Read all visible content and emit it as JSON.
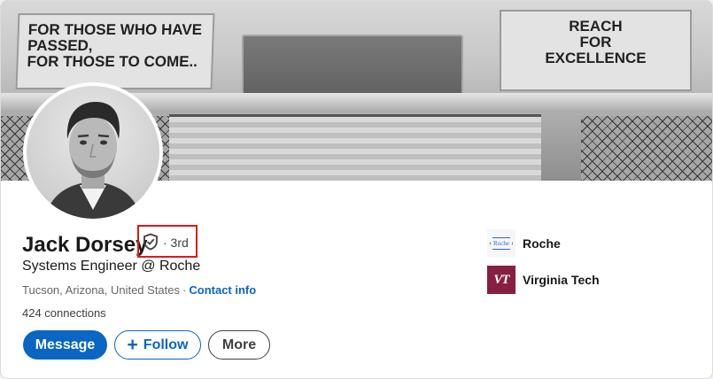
{
  "banner": {
    "left_plaque": [
      "FOR THOSE WHO HAVE",
      "PASSED,",
      "FOR THOSE TO COME.."
    ],
    "right_plaque": [
      "REACH",
      "FOR",
      "EXCELLENCE"
    ]
  },
  "profile": {
    "name": "Jack Dorsey",
    "verified_icon": "shield-check-icon",
    "degree": "· 3rd",
    "headline": "Systems Engineer @ Roche",
    "location": "Tucson, Arizona, United States",
    "separator": "·",
    "contact_info": "Contact info",
    "connections": "424 connections"
  },
  "actions": {
    "message": "Message",
    "follow_icon": "+",
    "follow": "Follow",
    "more": "More"
  },
  "orgs": [
    {
      "name": "Roche",
      "logo_text": "Roche",
      "logo_color": "#2b6cc4"
    },
    {
      "name": "Virginia Tech",
      "logo_text": "VT",
      "logo_color": "#861f41"
    }
  ],
  "colors": {
    "accent": "#0a66c2",
    "highlight_box": "#e0181b"
  }
}
